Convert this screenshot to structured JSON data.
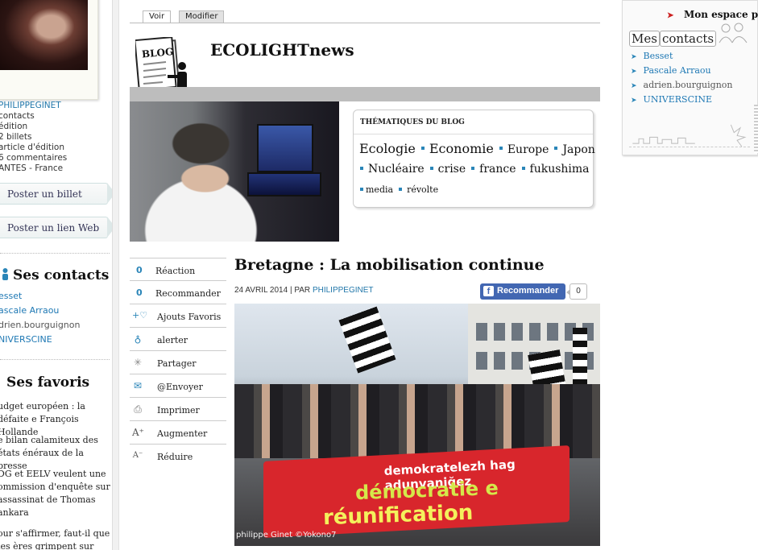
{
  "tabs": {
    "view": "Voir",
    "edit": "Modifier"
  },
  "blog": {
    "icon_label": "BLOG",
    "title": "ECOLIGHTnews"
  },
  "profile": {
    "username": "PHILIPPEGINET",
    "stats": [
      "contacts",
      "édition",
      "2 billets",
      "article d'édition",
      "6 commentaires",
      "ANTES - France"
    ]
  },
  "left_buttons": {
    "post_billet": "Poster un billet",
    "post_link": "Poster un lien Web"
  },
  "contacts": {
    "title": "Ses contacts",
    "items": [
      "esset",
      "ascale Arraou",
      "drien.bourguignon",
      "NIVERSCINE"
    ]
  },
  "favorites": {
    "title": "Ses favoris",
    "items": [
      "udget européen : la défaite e François Hollande",
      "e bilan calamiteux des états énéraux de la presse",
      "DG et EELV veulent une ommission d'enquête sur assassinat de Thomas ankara",
      "our s'affirmer, faut-il que les ères grimpent sur des grues ?"
    ]
  },
  "themes": {
    "title": "THÉMATIQUES DU BLOG",
    "row1": [
      "Ecologie",
      "Economie",
      "Europe",
      "Japon"
    ],
    "row2": [
      "Nucléaire",
      "crise",
      "france",
      "fukushima"
    ],
    "row3": [
      "media",
      "révolte"
    ]
  },
  "actions": {
    "reaction_count": "0",
    "reaction": "Réaction",
    "recommend_count": "0",
    "recommend": "Recommander",
    "favorites": "Ajouts Favoris",
    "alert": "alerter",
    "share": "Partager",
    "send": "@Envoyer",
    "print": "Imprimer",
    "increase": "Augmenter",
    "decrease": "Réduire"
  },
  "post": {
    "title": "Bretagne : La mobilisation continue",
    "date": "24 AVRIL 2014 |",
    "by": "PAR",
    "author": "PHILIPPEGINET",
    "fb_label": "Recommander",
    "fb_count": "0",
    "banner_line1": "demokratelezh hag adunvaniğez",
    "banner_line2": "démocratie e",
    "banner_line3": "réunification",
    "photo_credit": "philippe Ginet ©Yokono7"
  },
  "right": {
    "my_space": "Mon espace perso",
    "my_contacts_a": "Mes",
    "my_contacts_b": "contacts",
    "contacts": [
      "Besset",
      "Pascale Arraou",
      "adrien.bourguignon",
      "UNIVERSCINE"
    ],
    "contact_colors": [
      "#1e78b4",
      "#1e78b4",
      "#555555",
      "#1e78b4"
    ]
  },
  "colors": {
    "link": "#1e78b4",
    "accent_dot": "#2a85b8",
    "fb_blue": "#4267b2",
    "banner_red": "#d8262c"
  },
  "icons": [
    "person-icon",
    "plus-heart-icon",
    "alert-icon",
    "share-icon",
    "mail-icon",
    "printer-icon",
    "font-plus-icon",
    "font-minus-icon",
    "red-arrow-icon",
    "chevron-right-icon",
    "facebook-icon"
  ]
}
